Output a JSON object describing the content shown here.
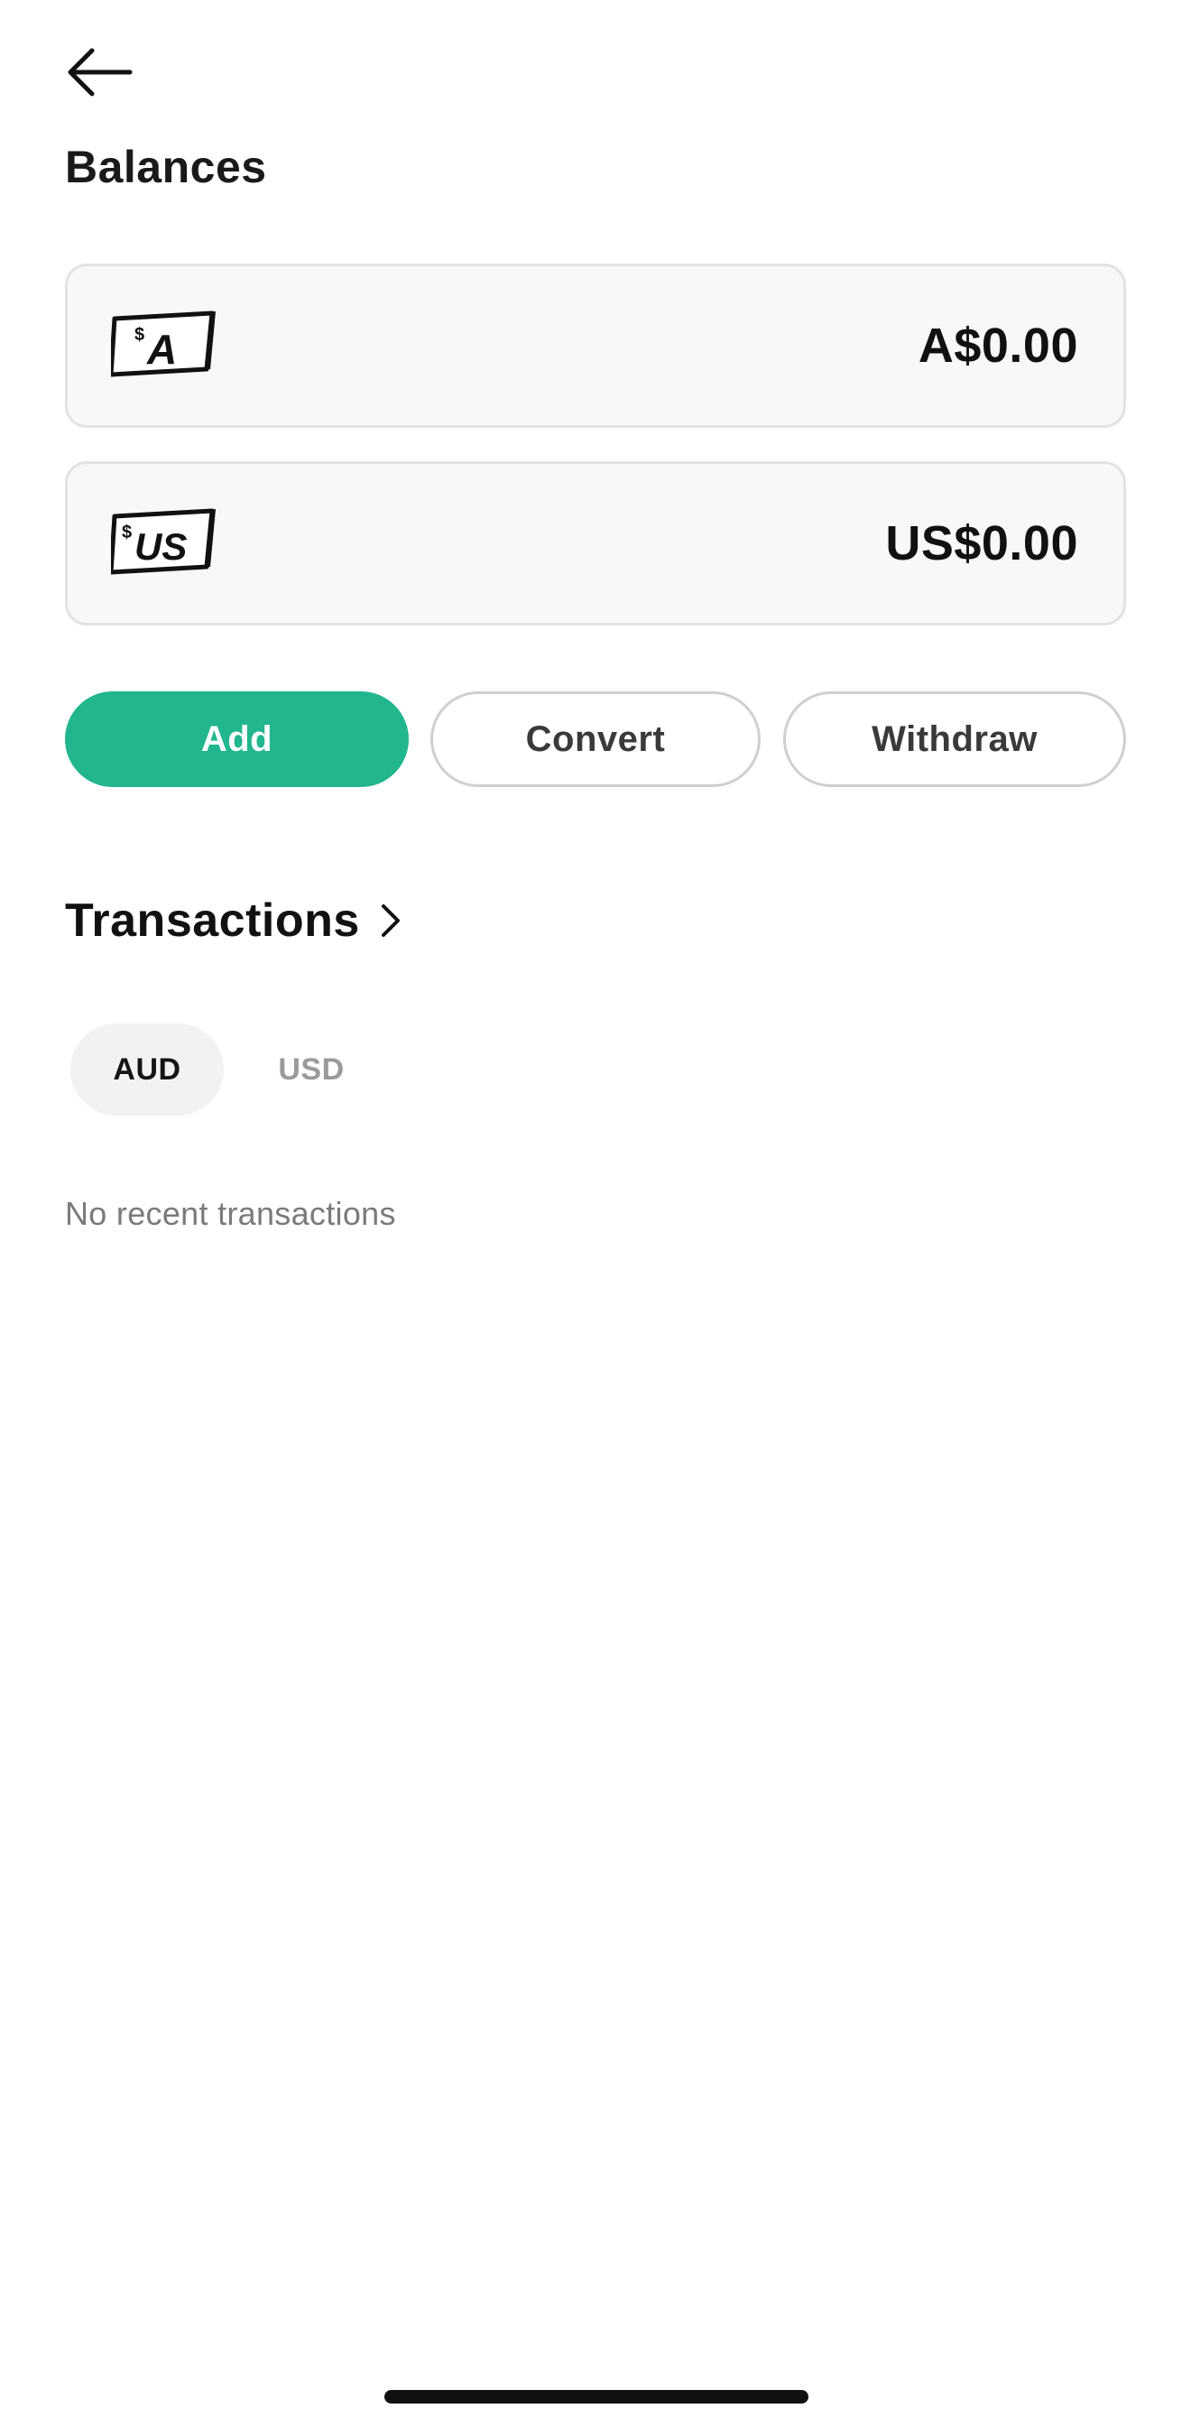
{
  "header": {
    "back_icon": "arrow-left-icon",
    "title": "Balances"
  },
  "balances": [
    {
      "currency_icon": "aud-cash-icon",
      "icon_text": "A",
      "amount": "A$0.00"
    },
    {
      "currency_icon": "usd-cash-icon",
      "icon_text": "US",
      "amount": "US$0.00"
    }
  ],
  "actions": {
    "add_label": "Add",
    "convert_label": "Convert",
    "withdraw_label": "Withdraw"
  },
  "transactions": {
    "title": "Transactions",
    "chevron_icon": "chevron-right-icon",
    "tabs": [
      {
        "label": "AUD",
        "selected": true
      },
      {
        "label": "USD",
        "selected": false
      }
    ],
    "empty_message": "No recent transactions"
  },
  "colors": {
    "accent": "#21b68e",
    "card_background": "#f8f8f8",
    "card_border": "#e3e3e3",
    "muted_text": "#7a7a7a",
    "inactive_tab": "#9a9a9a"
  }
}
